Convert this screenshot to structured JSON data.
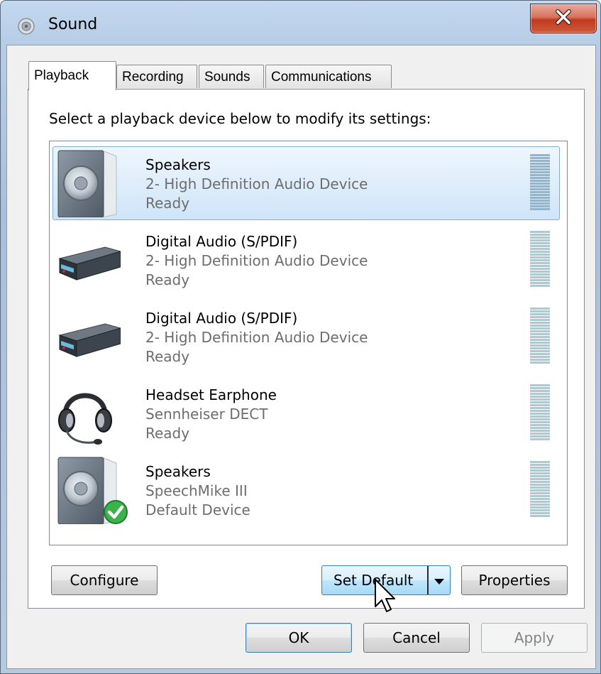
{
  "window": {
    "title": "Sound",
    "title_icon": "speaker-icon",
    "close_icon": "close-icon",
    "colors": {
      "close_button": "#c2391d",
      "selection": "#cfe5f9",
      "frame": "#b7cde6"
    }
  },
  "tabs": [
    {
      "label": "Playback",
      "active": true
    },
    {
      "label": "Recording",
      "active": false
    },
    {
      "label": "Sounds",
      "active": false
    },
    {
      "label": "Communications",
      "active": false
    }
  ],
  "instruction": "Select a playback device below to modify its settings:",
  "devices": [
    {
      "name": "Speakers",
      "description": "2- High Definition Audio Device",
      "status": "Ready",
      "icon": "speaker-icon",
      "selected": true,
      "default": false
    },
    {
      "name": "Digital Audio (S/PDIF)",
      "description": "2- High Definition Audio Device",
      "status": "Ready",
      "icon": "digital-audio-receiver-icon",
      "selected": false,
      "default": false
    },
    {
      "name": "Digital Audio (S/PDIF)",
      "description": "2- High Definition Audio Device",
      "status": "Ready",
      "icon": "digital-audio-receiver-icon",
      "selected": false,
      "default": false
    },
    {
      "name": "Headset Earphone",
      "description": "Sennheiser DECT",
      "status": "Ready",
      "icon": "headset-icon",
      "selected": false,
      "default": false
    },
    {
      "name": "Speakers",
      "description": "SpeechMike III",
      "status": "Default Device",
      "icon": "speaker-icon",
      "selected": false,
      "default": true
    }
  ],
  "buttons": {
    "configure": "Configure",
    "set_default": "Set Default",
    "properties": "Properties",
    "ok": "OK",
    "cancel": "Cancel",
    "apply": "Apply"
  }
}
